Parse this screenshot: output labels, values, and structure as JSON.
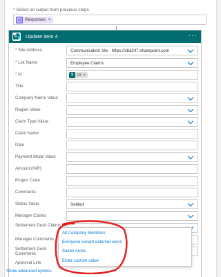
{
  "previous": {
    "label": "* Select an output from previous steps",
    "token_label": "Responses",
    "token_remove": "×"
  },
  "card": {
    "title": "Update item 4",
    "more": "···",
    "sp_letter": "S"
  },
  "fields": [
    {
      "label": "* Site Address",
      "value": "Communication site - https://cba247.sharepoint.com",
      "dropdown": true
    },
    {
      "label": "* List Name",
      "value": "Employee Claims",
      "dropdown": true
    },
    {
      "label": "* Id",
      "value": "",
      "dropdown": false,
      "token": "ID"
    },
    {
      "label": "Title",
      "value": "",
      "dropdown": false
    },
    {
      "label": "Company Name Value",
      "value": "",
      "dropdown": true
    },
    {
      "label": "Region Value",
      "value": "",
      "dropdown": true
    },
    {
      "label": "Claim Type Value",
      "value": "",
      "dropdown": true
    },
    {
      "label": "Claim Name",
      "value": "",
      "dropdown": false
    },
    {
      "label": "Date",
      "value": "",
      "dropdown": false
    },
    {
      "label": "Payment Mode Value",
      "value": "",
      "dropdown": true
    },
    {
      "label": "Amount (INR)",
      "value": "",
      "dropdown": false
    },
    {
      "label": "Project Code",
      "value": "",
      "dropdown": false
    },
    {
      "label": "Comments",
      "value": "",
      "dropdown": false
    },
    {
      "label": "Status Value",
      "value": "Settled",
      "dropdown": true
    },
    {
      "label": "Manager Claims",
      "value": "",
      "dropdown": true
    },
    {
      "label": "Settlement Desk Claims",
      "value": "",
      "dropdown": true
    },
    {
      "label": "Manager Comments",
      "value": "",
      "dropdown": false
    },
    {
      "label": "Settlement Desk Comments",
      "value": "",
      "dropdown": false
    },
    {
      "label": "Approval Link",
      "value": "",
      "dropdown": false
    }
  ],
  "id_token": {
    "label": "ID",
    "remove": "×"
  },
  "dropdown_options": [
    "All Company Members",
    "Everyone except external users",
    "Saloni Arora",
    "Enter custom value"
  ],
  "show_advanced": "Show advanced options",
  "colors": {
    "header": "#036c70",
    "link": "#0078d4",
    "annotation": "#e02020"
  }
}
